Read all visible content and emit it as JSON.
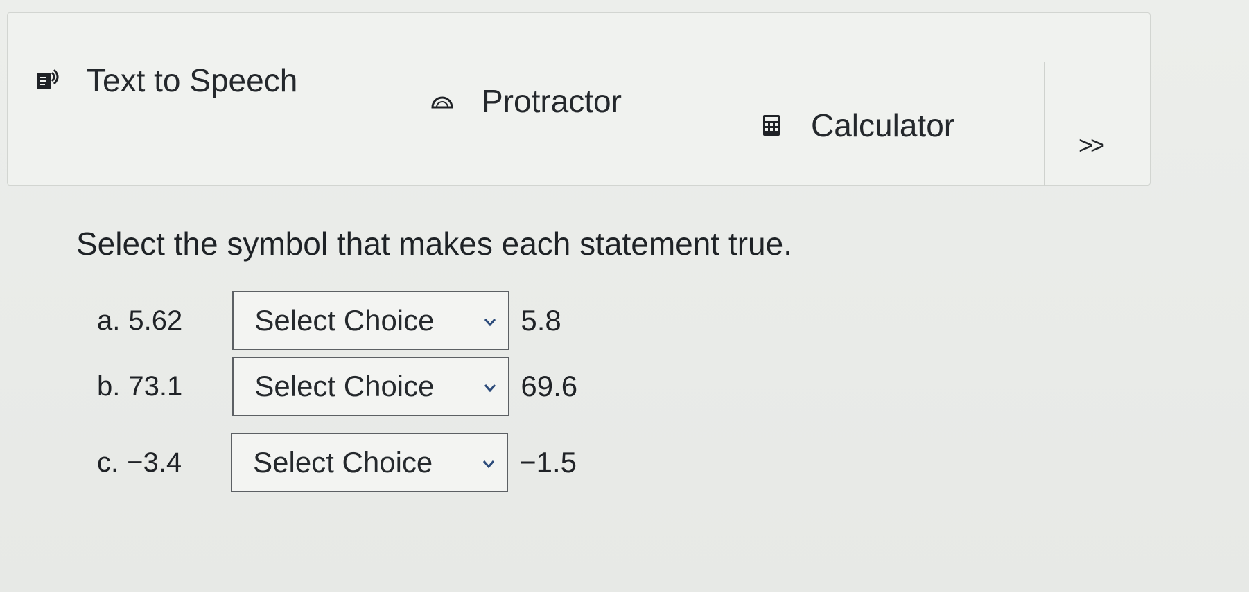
{
  "toolbar": {
    "tools": [
      {
        "label": "Text to Speech",
        "icon": "speaker-doc-icon"
      },
      {
        "label": "Protractor",
        "icon": "protractor-icon"
      },
      {
        "label": "Calculator",
        "icon": "calculator-icon"
      }
    ],
    "more_label": ">>"
  },
  "question": {
    "prompt": "Select the symbol that makes each statement true.",
    "items": [
      {
        "letter": "a.",
        "left": "5.62",
        "select": "Select Choice",
        "right": "5.8"
      },
      {
        "letter": "b.",
        "left": "73.1",
        "select": "Select Choice",
        "right": "69.6"
      },
      {
        "letter": "c.",
        "left": "−3.4",
        "select": "Select Choice",
        "right": "−1.5"
      }
    ]
  },
  "colors": {
    "background": "#e9ebe8",
    "toolbar": "#f0f2ef",
    "text": "#1f2226",
    "select_border": "#5c6064"
  }
}
